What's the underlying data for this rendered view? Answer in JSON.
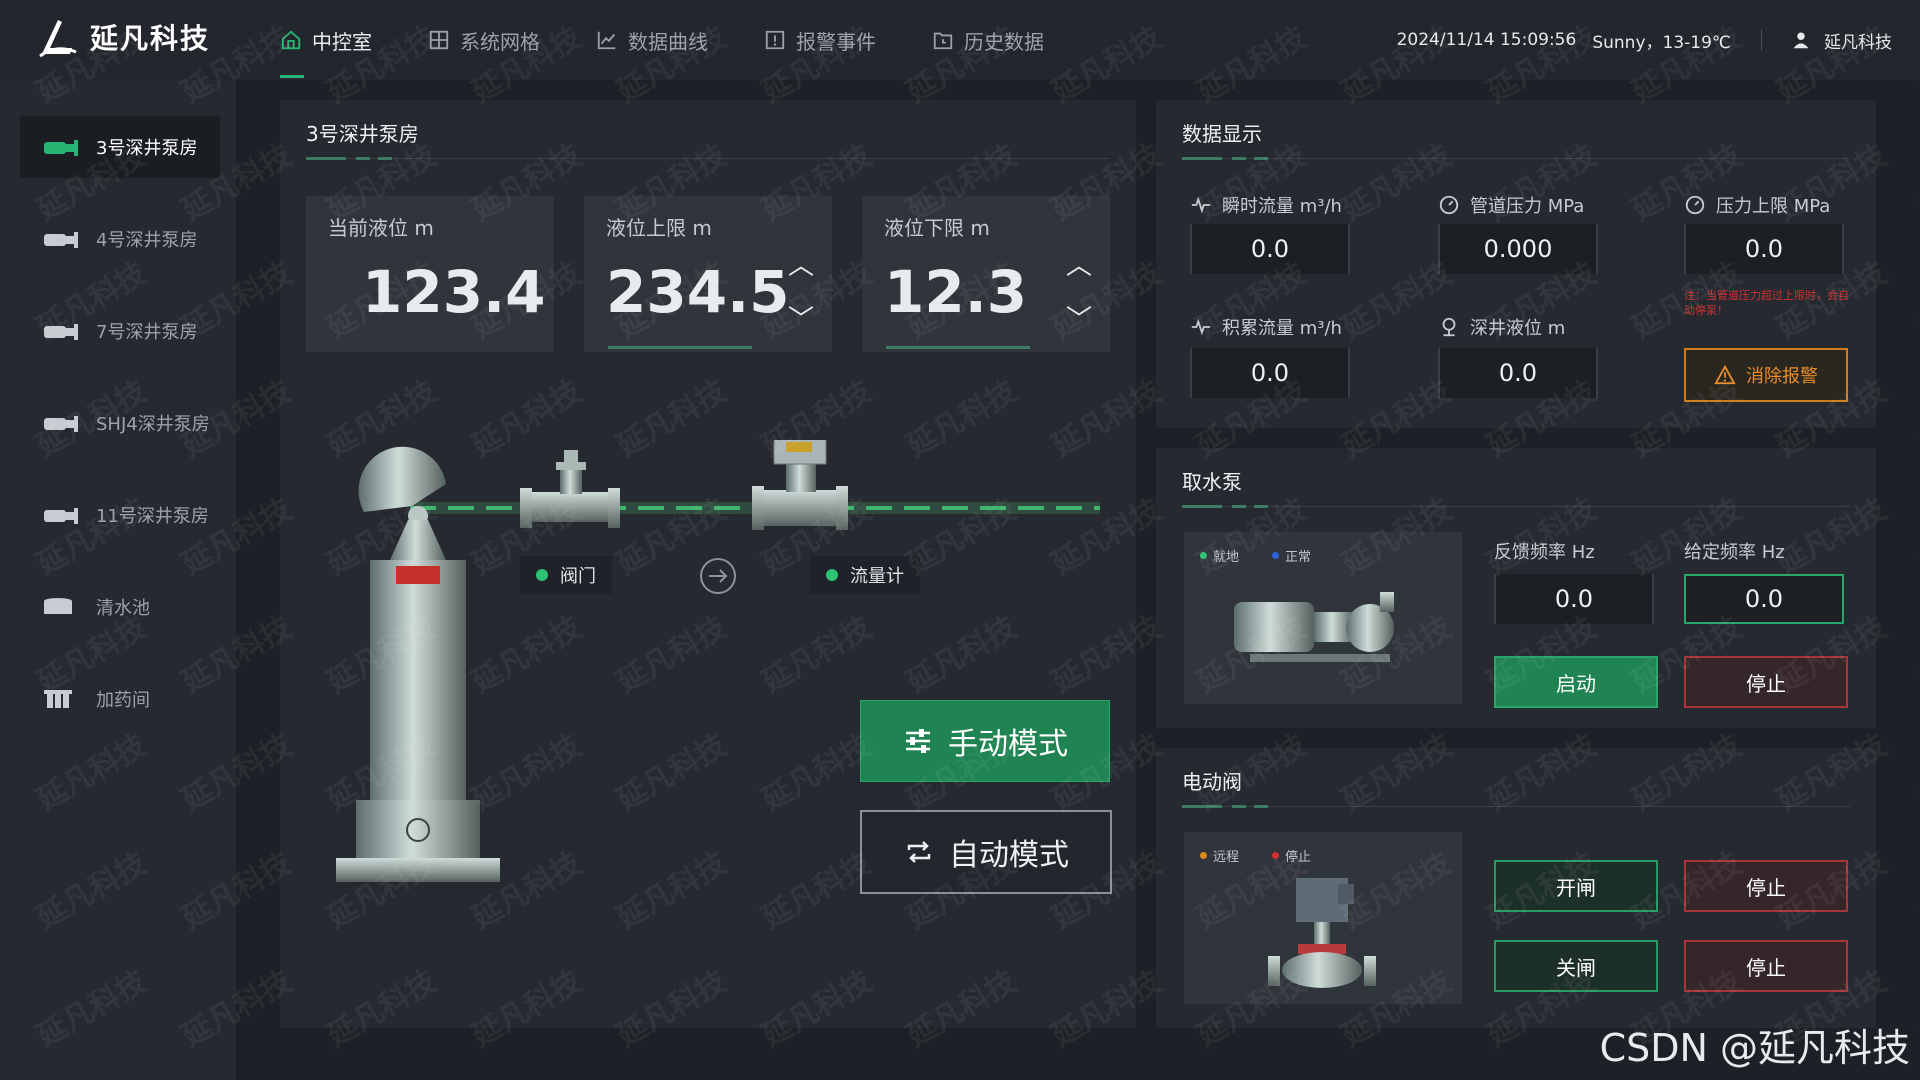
{
  "header": {
    "brand": "延凡科技",
    "datetime": "2024/11/14 15:09:56",
    "weather": "Sunny，13-19℃",
    "user": "延凡科技"
  },
  "nav": [
    {
      "label": "中控室",
      "icon": "home-icon",
      "active": true
    },
    {
      "label": "系统网格",
      "icon": "grid-icon",
      "active": false
    },
    {
      "label": "数据曲线",
      "icon": "chart-line-icon",
      "active": false
    },
    {
      "label": "报警事件",
      "icon": "alarm-icon",
      "active": false
    },
    {
      "label": "历史数据",
      "icon": "history-icon",
      "active": false
    }
  ],
  "sidebar": [
    {
      "label": "3号深井泵房",
      "icon": "pump-icon",
      "active": true
    },
    {
      "label": "4号深井泵房",
      "icon": "pump-icon",
      "active": false
    },
    {
      "label": "7号深井泵房",
      "icon": "pump-icon",
      "active": false
    },
    {
      "label": "SHJ4深井泵房",
      "icon": "pump-icon",
      "active": false
    },
    {
      "label": "11号深井泵房",
      "icon": "pump-icon",
      "active": false
    },
    {
      "label": "清水池",
      "icon": "tank-icon",
      "active": false
    },
    {
      "label": "加药间",
      "icon": "dosing-icon",
      "active": false
    }
  ],
  "main": {
    "title": "3号深井泵房",
    "levels": [
      {
        "label": "当前液位  m",
        "value": "123.4",
        "adjustable": false
      },
      {
        "label": "液位上限  m",
        "value": "234.5",
        "adjustable": true
      },
      {
        "label": "液位下限  m",
        "value": "12.3",
        "adjustable": true
      }
    ],
    "valve_label": "阀门",
    "flowmeter_label": "流量计",
    "manual_mode": "手动模式",
    "auto_mode": "自动模式"
  },
  "data_panel": {
    "title": "数据显示",
    "instant_flow": {
      "label": "瞬时流量  m³/h",
      "value": "0.0"
    },
    "pipe_pressure": {
      "label": "管道压力  MPa",
      "value": "0.000"
    },
    "pressure_limit": {
      "label": "压力上限  MPa",
      "value": "0.0"
    },
    "cumulative_flow": {
      "label": "积累流量  m³/h",
      "value": "0.0"
    },
    "well_level": {
      "label": "深井液位  m",
      "value": "0.0"
    },
    "warning_text": "注：当管道压力超过上限时，会自动停泵！",
    "clear_alarm": "消除报警"
  },
  "pump_panel": {
    "title": "取水泵",
    "legend_local": "就地",
    "legend_normal": "正常",
    "feedback_freq": {
      "label": "反馈频率  Hz",
      "value": "0.0"
    },
    "set_freq": {
      "label": "给定频率  Hz",
      "value": "0.0"
    },
    "start": "启动",
    "stop": "停止"
  },
  "valve_panel": {
    "title": "电动阀",
    "legend_remote": "远程",
    "legend_stop": "停止",
    "open": "开闸",
    "open_stop": "停止",
    "close": "关闸",
    "close_stop": "停止"
  },
  "watermark": "延凡科技",
  "footer_credit": "CSDN @延凡科技",
  "colors": {
    "accent": "#27b573",
    "danger": "#a6343c",
    "warning": "#d07c1a"
  }
}
